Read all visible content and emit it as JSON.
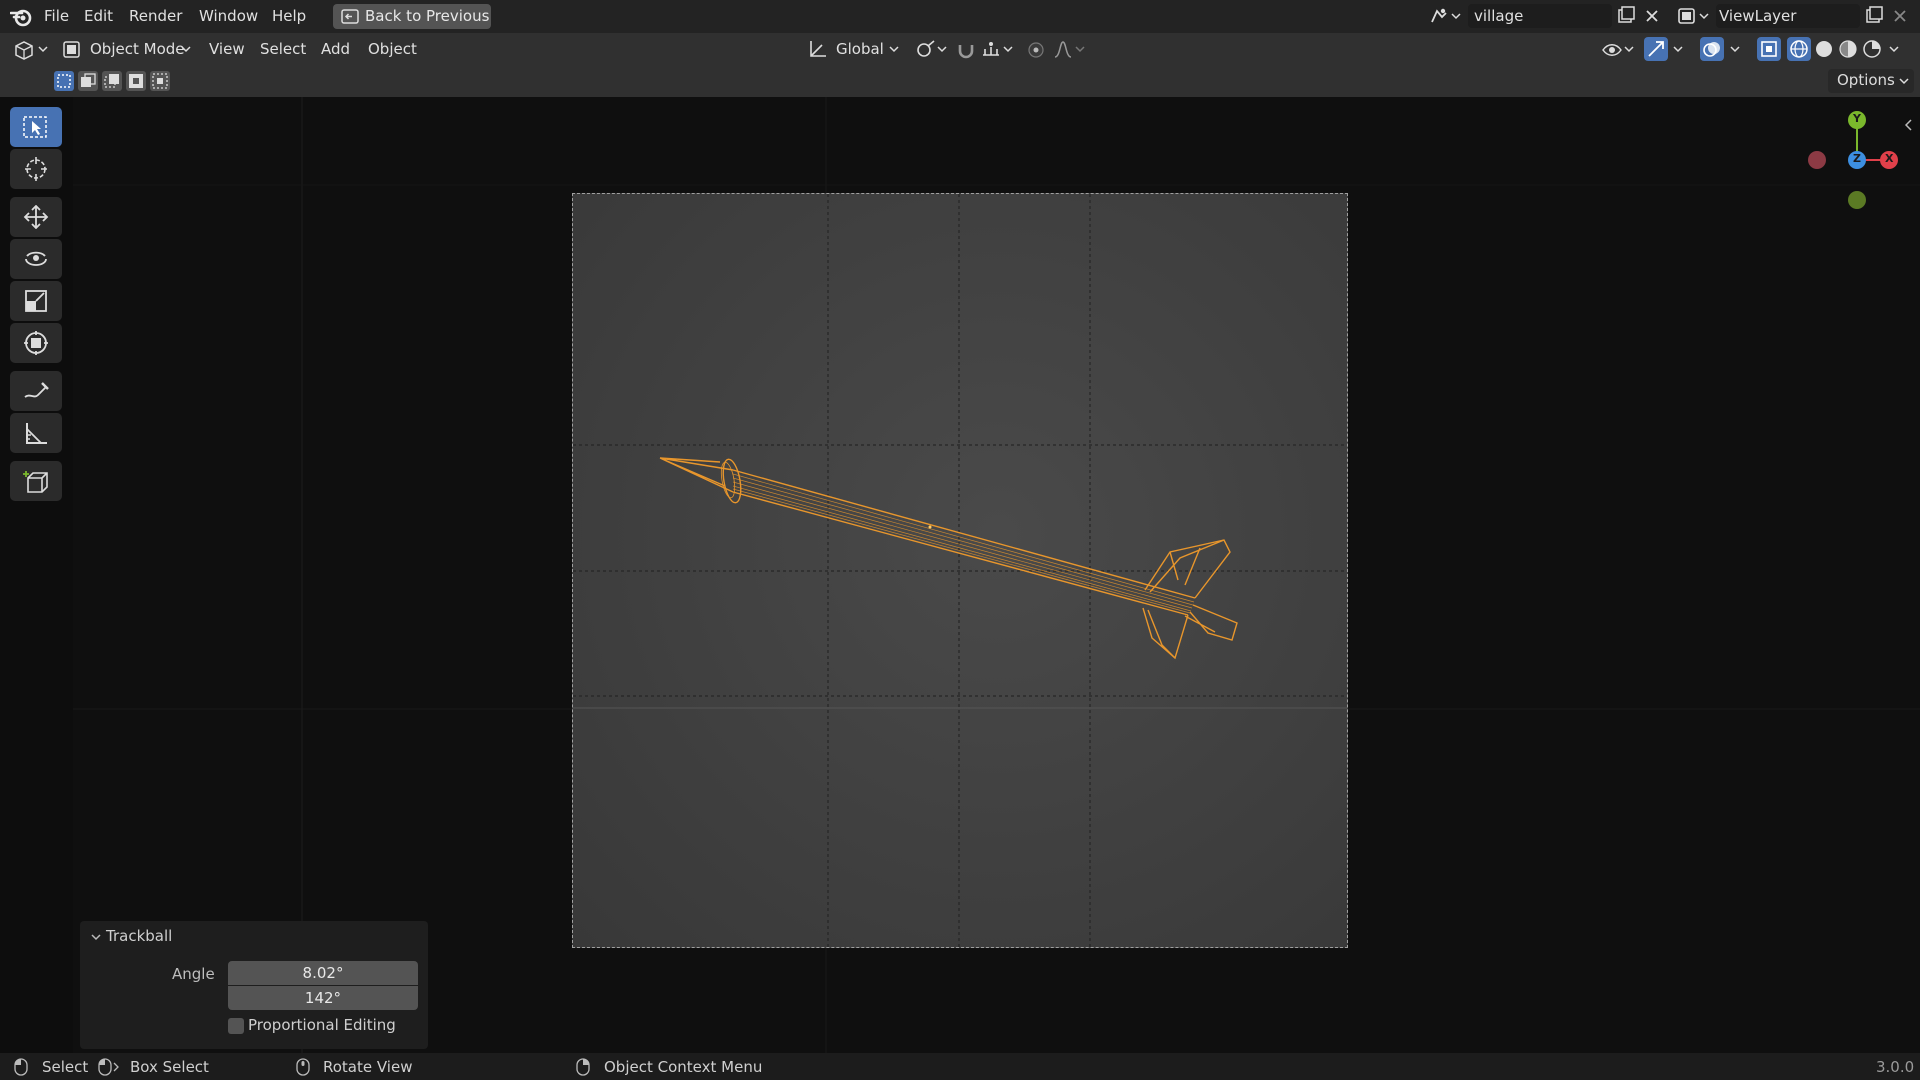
{
  "menu": {
    "items": [
      "File",
      "Edit",
      "Render",
      "Window",
      "Help"
    ],
    "back_button": "Back to Previous"
  },
  "scene": {
    "name": "village"
  },
  "view_layer": {
    "name": "ViewLayer"
  },
  "header": {
    "mode": "Object Mode",
    "menus": [
      "View",
      "Select",
      "Add",
      "Object"
    ],
    "transform_orientation": "Global",
    "options": "Options"
  },
  "gizmo": {
    "y": "Y",
    "z": "Z",
    "x": "X"
  },
  "operator_panel": {
    "title": "Trackball",
    "angle_label": "Angle",
    "angle_values": [
      "8.02°",
      "142°"
    ],
    "proportional_editing": "Proportional Editing"
  },
  "statusbar": {
    "select": "Select",
    "box_select": "Box Select",
    "rotate_view": "Rotate View",
    "context_menu": "Object Context Menu",
    "version": "3.0.0"
  },
  "colors": {
    "accent": "#4772b3",
    "selection": "#f0a030",
    "axis_x": "#e0404a",
    "axis_y": "#7ab82c",
    "axis_z": "#3d8fe0"
  }
}
